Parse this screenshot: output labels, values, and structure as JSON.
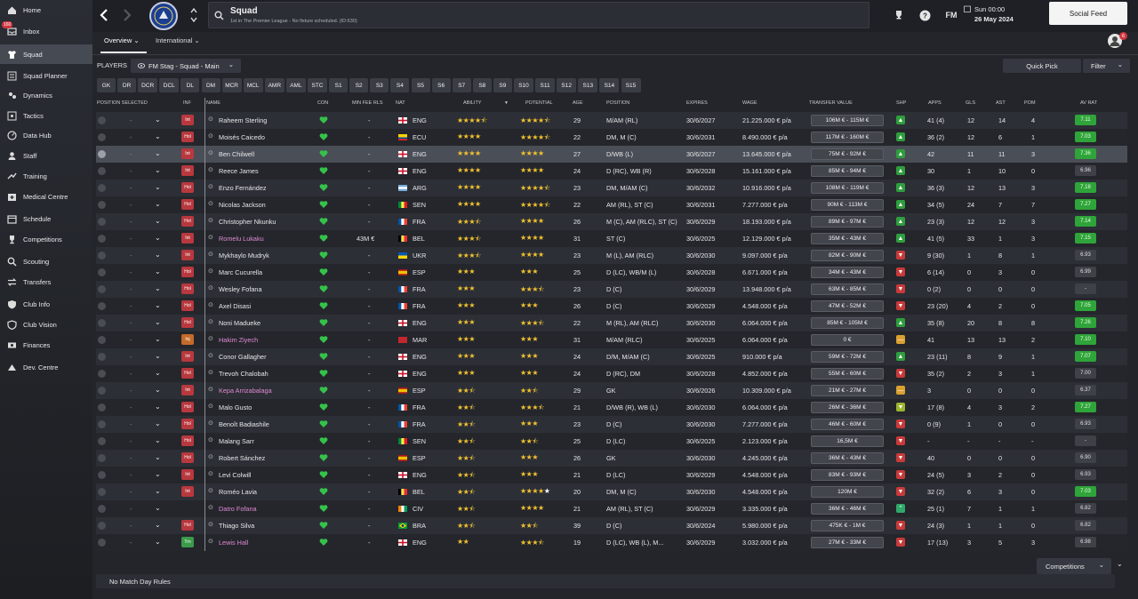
{
  "sidebar": {
    "items": [
      {
        "label": "Home",
        "icon": "home-icon"
      },
      {
        "label": "Inbox",
        "icon": "inbox-icon",
        "badge": "160"
      },
      {
        "label": "Squad",
        "icon": "shirt-icon",
        "active": true
      },
      {
        "label": "Squad Planner",
        "icon": "planner-icon"
      },
      {
        "label": "Dynamics",
        "icon": "dynamics-icon"
      },
      {
        "label": "Tactics",
        "icon": "tactics-icon"
      },
      {
        "label": "Data Hub",
        "icon": "data-hub-icon"
      },
      {
        "label": "Staff",
        "icon": "staff-icon"
      },
      {
        "label": "Training",
        "icon": "training-icon"
      },
      {
        "label": "Medical Centre",
        "icon": "medical-icon"
      },
      {
        "label": "Schedule",
        "icon": "calendar-icon"
      },
      {
        "label": "Competitions",
        "icon": "trophy-icon"
      },
      {
        "label": "Scouting",
        "icon": "scouting-icon"
      },
      {
        "label": "Transfers",
        "icon": "transfers-icon"
      },
      {
        "label": "Club Info",
        "icon": "shield-icon"
      },
      {
        "label": "Club Vision",
        "icon": "vision-icon"
      },
      {
        "label": "Finances",
        "icon": "finances-icon"
      },
      {
        "label": "Dev. Centre",
        "icon": "dev-centre-icon"
      }
    ]
  },
  "topbar": {
    "title": "Squad",
    "subtitle": "1st in The Premier League - No fixture scheduled. (ID:630)",
    "fm_label": "FM",
    "day_time": "Sun 00:00",
    "date": "26 May 2024",
    "social_feed": "Social Feed",
    "notif_count": "6"
  },
  "tabs": {
    "overview": "Overview",
    "international": "International"
  },
  "toolbar": {
    "players_label": "PLAYERS",
    "view_select": "FM Stag - Squad - Main",
    "quick_pick": "Quick Pick",
    "filter": "Filter"
  },
  "positions": [
    "GK",
    "DR",
    "DCR",
    "DCL",
    "DL",
    "DM",
    "MCR",
    "MCL",
    "AMR",
    "AML",
    "STC",
    "S1",
    "S2",
    "S3",
    "S4",
    "S5",
    "S6",
    "S7",
    "S8",
    "S9",
    "S10",
    "S11",
    "S12",
    "S13",
    "S14",
    "S15"
  ],
  "headers": {
    "position_selected": "POSITION SELECTED",
    "inf": "INF",
    "name": "NAME",
    "con": "CON",
    "min_fee": "MIN FEE RLS",
    "nat": "NAT",
    "ability": "ABILITY",
    "potential": "POTENTIAL",
    "age": "AGE",
    "position": "POSITION",
    "expires": "EXPIRES",
    "wage": "WAGE",
    "transfer_value": "TRANSFER VALUE",
    "shp": "SHP",
    "apps": "APPS",
    "gls": "GLS",
    "ast": "AST",
    "pom": "POM",
    "av_rat": "AV RAT"
  },
  "players": [
    {
      "name": "Raheem Sterling",
      "inf": "Int",
      "minfee": "-",
      "nat": "ENG",
      "ab": 4.5,
      "pot": 4.5,
      "age": "29",
      "pos": "M/AM (RL)",
      "exp": "30/6/2027",
      "wage": "21.225.000 € p/a",
      "tv": "106M € - 115M €",
      "shp": "up",
      "apps": "41 (4)",
      "gls": "12",
      "ast": "14",
      "pom": "4",
      "rat": "7.11"
    },
    {
      "name": "Moisés Caicedo",
      "inf": "Hol",
      "minfee": "-",
      "nat": "ECU",
      "ab": 4,
      "pot": 4.5,
      "age": "22",
      "pos": "DM, M (C)",
      "exp": "30/6/2031",
      "wage": "8.490.000 € p/a",
      "tv": "117M € - 160M €",
      "shp": "up",
      "apps": "36 (2)",
      "gls": "12",
      "ast": "6",
      "pom": "1",
      "rat": "7.03"
    },
    {
      "name": "Ben Chilwell",
      "inf": "Int",
      "minfee": "-",
      "nat": "ENG",
      "ab": 4,
      "pot": 4,
      "age": "27",
      "pos": "D/WB (L)",
      "exp": "30/6/2027",
      "wage": "13.645.000 € p/a",
      "tv": "75M € - 92M €",
      "shp": "up",
      "apps": "42",
      "gls": "11",
      "ast": "11",
      "pom": "3",
      "rat": "7.36",
      "sel": true
    },
    {
      "name": "Reece James",
      "inf": "Int",
      "minfee": "-",
      "nat": "ENG",
      "ab": 4,
      "pot": 4,
      "age": "24",
      "pos": "D (RC), WB (R)",
      "exp": "30/6/2028",
      "wage": "15.161.000 € p/a",
      "tv": "85M € - 94M €",
      "shp": "up",
      "apps": "30",
      "gls": "1",
      "ast": "10",
      "pom": "0",
      "rat": "6.96"
    },
    {
      "name": "Enzo Fernández",
      "inf": "Hol",
      "minfee": "-",
      "nat": "ARG",
      "ab": 4,
      "pot": 4.5,
      "age": "23",
      "pos": "DM, M/AM (C)",
      "exp": "30/6/2032",
      "wage": "10.916.000 € p/a",
      "tv": "108M € - 119M €",
      "shp": "up",
      "apps": "36 (3)",
      "gls": "12",
      "ast": "13",
      "pom": "3",
      "rat": "7.18"
    },
    {
      "name": "Nicolas Jackson",
      "inf": "Hol",
      "minfee": "-",
      "nat": "SEN",
      "ab": 4,
      "pot": 4.5,
      "age": "22",
      "pos": "AM (RL), ST (C)",
      "exp": "30/6/2031",
      "wage": "7.277.000 € p/a",
      "tv": "90M € - 113M €",
      "shp": "up",
      "apps": "34 (5)",
      "gls": "24",
      "ast": "7",
      "pom": "7",
      "rat": "7.27"
    },
    {
      "name": "Christopher Nkunku",
      "inf": "Hol",
      "minfee": "-",
      "nat": "FRA",
      "ab": 3.5,
      "pot": 4,
      "age": "26",
      "pos": "M (C), AM (RLC), ST (C)",
      "exp": "30/6/2029",
      "wage": "18.193.000 € p/a",
      "tv": "89M € - 97M €",
      "shp": "up",
      "apps": "23 (3)",
      "gls": "12",
      "ast": "12",
      "pom": "3",
      "rat": "7.14"
    },
    {
      "name": "Romelu Lukaku",
      "inf": "Int",
      "minfee": "43M €",
      "nat": "BEL",
      "ab": 3.5,
      "pot": 4,
      "age": "31",
      "pos": "ST (C)",
      "exp": "30/6/2025",
      "wage": "12.129.000 € p/a",
      "tv": "35M € - 43M €",
      "shp": "up",
      "apps": "41 (5)",
      "gls": "33",
      "ast": "1",
      "pom": "3",
      "rat": "7.15",
      "pink": true
    },
    {
      "name": "Mykhaylo Mudryk",
      "inf": "Int",
      "minfee": "-",
      "nat": "UKR",
      "ab": 3.5,
      "pot": 4,
      "age": "23",
      "pos": "M (L), AM (RLC)",
      "exp": "30/6/2030",
      "wage": "9.097.000 € p/a",
      "tv": "82M € - 90M €",
      "shp": "down",
      "apps": "9 (30)",
      "gls": "1",
      "ast": "8",
      "pom": "1",
      "rat": "6.93"
    },
    {
      "name": "Marc Cucurella",
      "inf": "Hol",
      "minfee": "-",
      "nat": "ESP",
      "ab": 3,
      "pot": 3,
      "age": "25",
      "pos": "D (LC), WB/M (L)",
      "exp": "30/6/2028",
      "wage": "6.671.000 € p/a",
      "tv": "34M € - 43M €",
      "shp": "down",
      "apps": "6 (14)",
      "gls": "0",
      "ast": "3",
      "pom": "0",
      "rat": "6.99"
    },
    {
      "name": "Wesley Fofana",
      "inf": "Hol",
      "minfee": "-",
      "nat": "FRA",
      "ab": 3,
      "pot": 3.5,
      "age": "23",
      "pos": "D (C)",
      "exp": "30/6/2029",
      "wage": "13.948.000 € p/a",
      "tv": "63M € - 85M €",
      "shp": "down",
      "apps": "0 (2)",
      "gls": "0",
      "ast": "0",
      "pom": "0",
      "rat": "-"
    },
    {
      "name": "Axel Disasi",
      "inf": "Hol",
      "minfee": "-",
      "nat": "FRA",
      "ab": 3,
      "pot": 3,
      "age": "26",
      "pos": "D (C)",
      "exp": "30/6/2029",
      "wage": "4.548.000 € p/a",
      "tv": "47M € - 52M €",
      "shp": "down",
      "apps": "23 (20)",
      "gls": "4",
      "ast": "2",
      "pom": "0",
      "rat": "7.05"
    },
    {
      "name": "Noni Madueke",
      "inf": "Hol",
      "minfee": "-",
      "nat": "ENG",
      "ab": 3,
      "pot": 3.5,
      "age": "22",
      "pos": "M (RL), AM (RLC)",
      "exp": "30/6/2030",
      "wage": "6.064.000 € p/a",
      "tv": "85M € - 105M €",
      "shp": "up",
      "apps": "35 (8)",
      "gls": "20",
      "ast": "8",
      "pom": "8",
      "rat": "7.26"
    },
    {
      "name": "Hakim Ziyech",
      "inf": "Inj",
      "minfee": "-",
      "nat": "MAR",
      "ab": 3,
      "pot": 3,
      "age": "31",
      "pos": "M/AM (RLC)",
      "exp": "30/6/2025",
      "wage": "6.064.000 € p/a",
      "tv": "0 €",
      "shp": "mid",
      "apps": "41",
      "gls": "13",
      "ast": "13",
      "pom": "2",
      "rat": "7.10",
      "pink": true
    },
    {
      "name": "Conor Gallagher",
      "inf": "Int",
      "minfee": "-",
      "nat": "ENG",
      "ab": 3,
      "pot": 3,
      "age": "24",
      "pos": "D/M, M/AM (C)",
      "exp": "30/6/2025",
      "wage": "910.000 € p/a",
      "tv": "59M € - 72M €",
      "shp": "up",
      "apps": "23 (11)",
      "gls": "8",
      "ast": "9",
      "pom": "1",
      "rat": "7.07"
    },
    {
      "name": "Trevoh Chalobah",
      "inf": "Hol",
      "minfee": "-",
      "nat": "ENG",
      "ab": 3,
      "pot": 3,
      "age": "24",
      "pos": "D (RC), DM",
      "exp": "30/6/2028",
      "wage": "4.852.000 € p/a",
      "tv": "55M € - 60M €",
      "shp": "down",
      "apps": "35 (2)",
      "gls": "2",
      "ast": "3",
      "pom": "1",
      "rat": "7.00"
    },
    {
      "name": "Kepa Arrizabalaga",
      "inf": "Int",
      "minfee": "-",
      "nat": "ESP",
      "ab": 2.5,
      "pot": 2.5,
      "age": "29",
      "pos": "GK",
      "exp": "30/6/2026",
      "wage": "10.309.000 € p/a",
      "tv": "21M € - 27M €",
      "shp": "mid",
      "apps": "3",
      "gls": "0",
      "ast": "0",
      "pom": "0",
      "rat": "6.37",
      "pink": true
    },
    {
      "name": "Malo Gusto",
      "inf": "Hol",
      "minfee": "-",
      "nat": "FRA",
      "ab": 2.5,
      "pot": 3.5,
      "age": "21",
      "pos": "D/WB (R), WB (L)",
      "exp": "30/6/2030",
      "wage": "6.064.000 € p/a",
      "tv": "26M € - 36M €",
      "shp": "lo",
      "apps": "17 (8)",
      "gls": "4",
      "ast": "3",
      "pom": "2",
      "rat": "7.27"
    },
    {
      "name": "Benoît Badiashile",
      "inf": "Hol",
      "minfee": "-",
      "nat": "FRA",
      "ab": 2.5,
      "pot": 3,
      "age": "23",
      "pos": "D (C)",
      "exp": "30/6/2030",
      "wage": "7.277.000 € p/a",
      "tv": "46M € - 60M €",
      "shp": "down",
      "apps": "0 (9)",
      "gls": "1",
      "ast": "0",
      "pom": "0",
      "rat": "6.93"
    },
    {
      "name": "Malang Sarr",
      "inf": "Hol",
      "minfee": "-",
      "nat": "SEN",
      "ab": 2.5,
      "pot": 2.5,
      "age": "25",
      "pos": "D (LC)",
      "exp": "30/6/2025",
      "wage": "2.123.000 € p/a",
      "tv": "16,5M €",
      "shp": "down",
      "apps": "-",
      "gls": "-",
      "ast": "-",
      "pom": "-",
      "rat": "-"
    },
    {
      "name": "Robert Sánchez",
      "inf": "Hol",
      "minfee": "-",
      "nat": "ESP",
      "ab": 2.5,
      "pot": 3,
      "age": "26",
      "pos": "GK",
      "exp": "30/6/2030",
      "wage": "4.245.000 € p/a",
      "tv": "36M € - 43M €",
      "shp": "down",
      "apps": "40",
      "gls": "0",
      "ast": "0",
      "pom": "0",
      "rat": "6.90"
    },
    {
      "name": "Levi Colwill",
      "inf": "Int",
      "minfee": "-",
      "nat": "ENG",
      "ab": 2.5,
      "pot": 3,
      "age": "21",
      "pos": "D (LC)",
      "exp": "30/6/2029",
      "wage": "4.548.000 € p/a",
      "tv": "83M € - 93M €",
      "shp": "down",
      "apps": "24 (5)",
      "gls": "3",
      "ast": "2",
      "pom": "0",
      "rat": "6.93"
    },
    {
      "name": "Roméo Lavia",
      "inf": "Int",
      "minfee": "-",
      "nat": "BEL",
      "ab": 2.5,
      "pot": 5,
      "age": "20",
      "pos": "DM, M (C)",
      "exp": "30/6/2030",
      "wage": "4.548.000 € p/a",
      "tv": "120M €",
      "shp": "down",
      "apps": "32 (2)",
      "gls": "6",
      "ast": "3",
      "pom": "0",
      "rat": "7.03"
    },
    {
      "name": "Datro Fofana",
      "inf": "",
      "minfee": "-",
      "nat": "CIV",
      "ab": 2.5,
      "pot": 4,
      "age": "21",
      "pos": "AM (RL), ST (C)",
      "exp": "30/6/2029",
      "wage": "3.335.000 € p/a",
      "tv": "36M € - 46M €",
      "shp": "up2",
      "apps": "25 (1)",
      "gls": "7",
      "ast": "1",
      "pom": "1",
      "rat": "6.82",
      "pink": true
    },
    {
      "name": "Thiago Silva",
      "inf": "Hol",
      "minfee": "-",
      "nat": "BRA",
      "ab": 2.5,
      "pot": 2.5,
      "age": "39",
      "pos": "D (C)",
      "exp": "30/6/2024",
      "wage": "5.980.000 € p/a",
      "tv": "475K € - 1M €",
      "shp": "down",
      "apps": "24 (3)",
      "gls": "1",
      "ast": "1",
      "pom": "0",
      "rat": "6.82"
    },
    {
      "name": "Lewis Hall",
      "inf": "Trn",
      "minfee": "-",
      "nat": "ENG",
      "ab": 2,
      "pot": 3.5,
      "age": "19",
      "pos": "D (LC), WB (L), M...",
      "exp": "30/6/2029",
      "wage": "3.032.000 € p/a",
      "tv": "27M € - 33M €",
      "shp": "down",
      "apps": "17 (13)",
      "gls": "3",
      "ast": "5",
      "pom": "3",
      "rat": "6.98",
      "pink": true
    }
  ],
  "footer": {
    "rules": "No Match Day Rules",
    "competitions": "Competitions"
  },
  "colors": {
    "accent": "#35c24a",
    "rating_green": "#2fa43a",
    "inf_red": "#b8383e"
  }
}
